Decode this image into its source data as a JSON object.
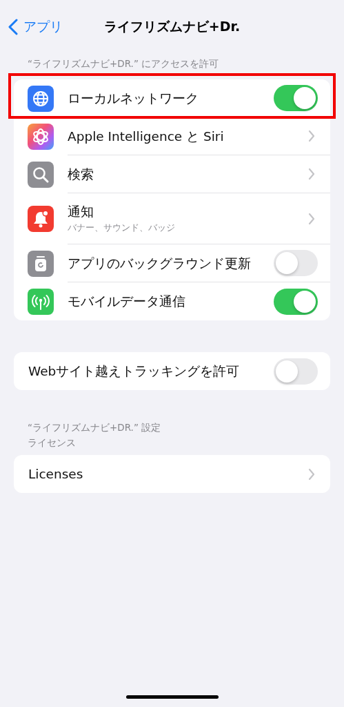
{
  "nav": {
    "back": "アプリ",
    "title": "ライフリズムナビ+Dr."
  },
  "sections": [
    {
      "header": "“ライフリズムナビ+DR.” にアクセスを許可",
      "items": [
        {
          "kind": "toggle",
          "label": "ローカルネットワーク",
          "on": true,
          "highlighted": true
        },
        {
          "kind": "link",
          "label": "Apple Intelligence と Siri",
          "highlighted": false
        },
        {
          "kind": "link",
          "label": "検索",
          "highlighted": false
        },
        {
          "kind": "link",
          "label": "通知",
          "subtitle": "バナー、サウンド、バッジ",
          "highlighted": false
        },
        {
          "kind": "toggle",
          "label": "アプリのバックグラウンド更新",
          "on": false,
          "highlighted": false
        },
        {
          "kind": "toggle",
          "label": "モバイルデータ通信",
          "on": true,
          "highlighted": false
        }
      ]
    },
    {
      "items": [
        {
          "kind": "toggle",
          "label": "Webサイト越えトラッキングを許可",
          "on": false,
          "highlighted": false
        }
      ]
    },
    {
      "header": "“ライフリズムナビ+DR.” 設定",
      "subheader": "ライセンス",
      "items": [
        {
          "kind": "link",
          "label": "Licenses",
          "highlighted": false
        }
      ]
    }
  ]
}
